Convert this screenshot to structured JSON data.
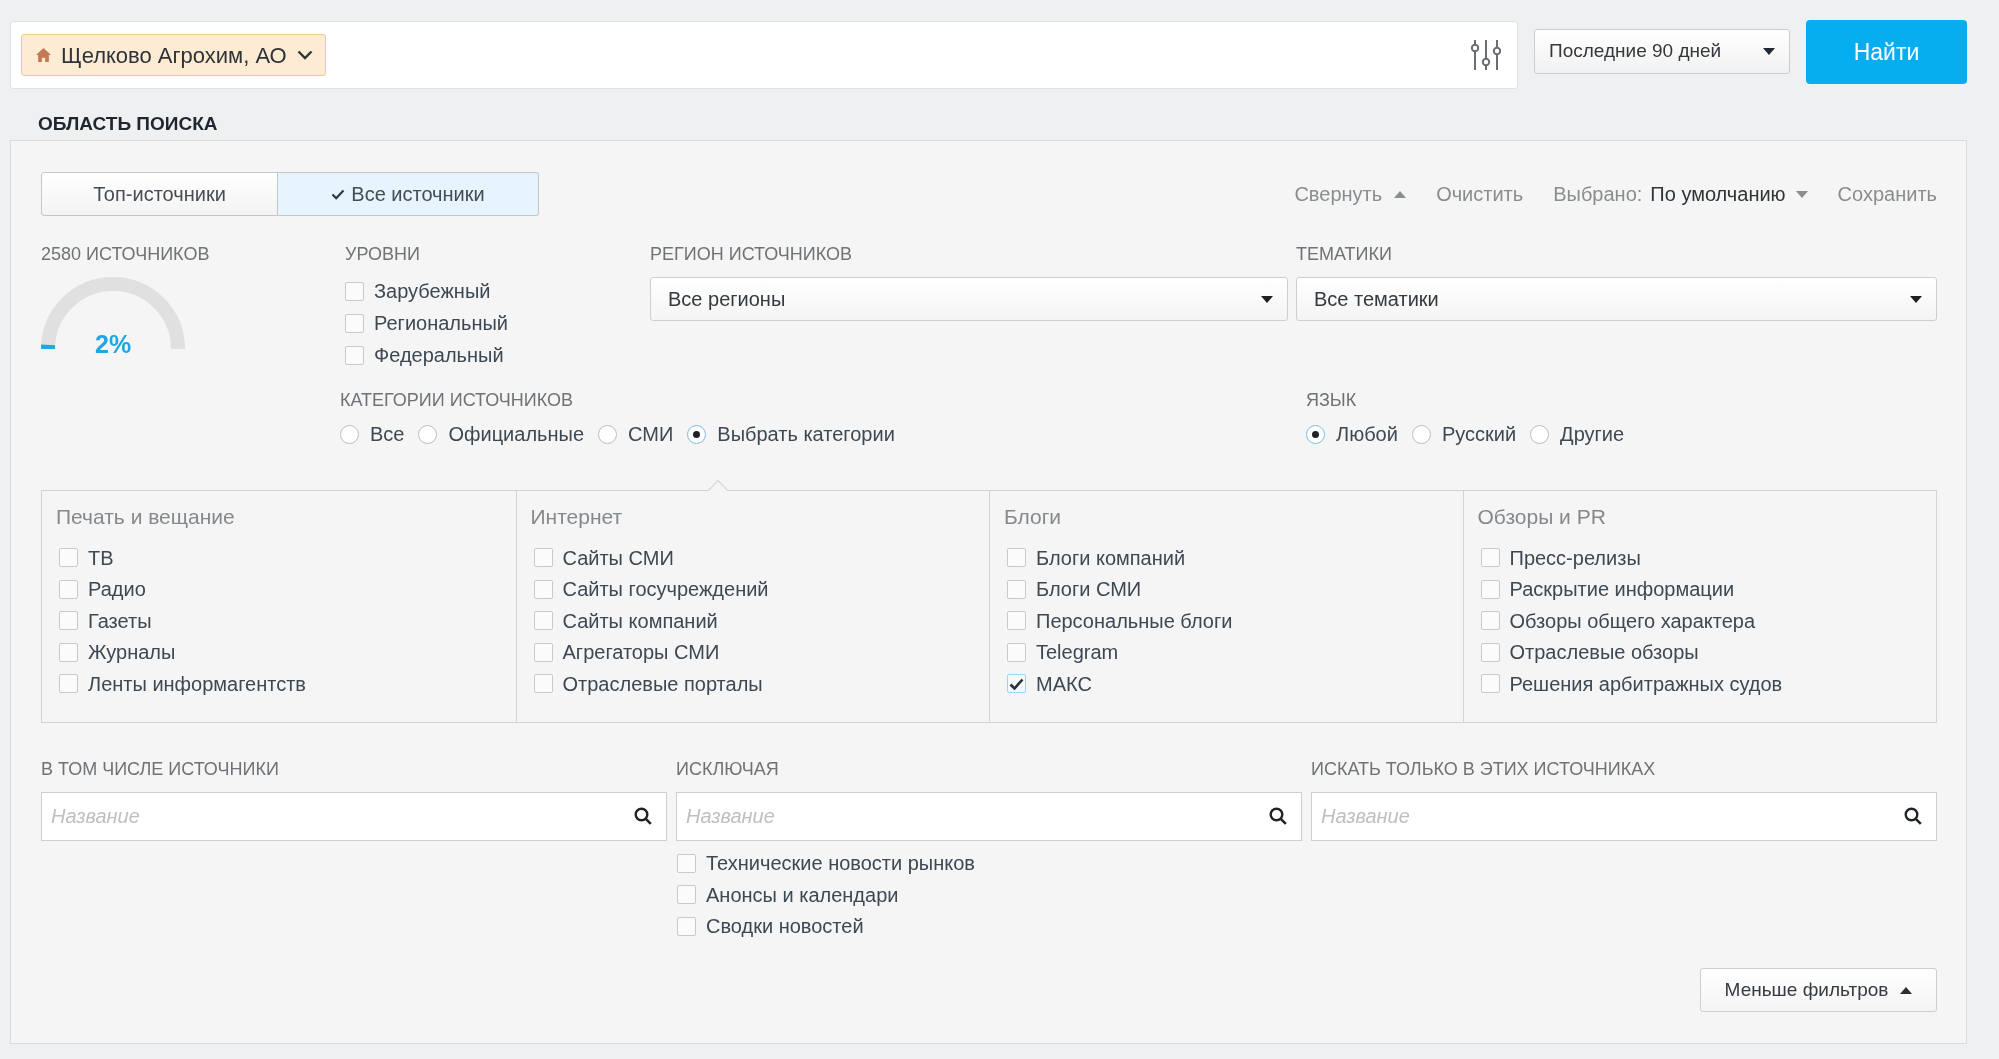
{
  "search_bar": {
    "company": "Щелково Агрохим, АО",
    "period": "Последние 90 дней",
    "find_button": "Найти"
  },
  "section_title": "ОБЛАСТЬ ПОИСКА",
  "source_tabs": [
    {
      "label": "Топ-источники",
      "selected": false
    },
    {
      "label": "Все источники",
      "selected": true
    }
  ],
  "actions": {
    "collapse": "Свернуть",
    "clear": "Очистить",
    "preset_label": "Выбрано:",
    "preset_value": "По умолчанию",
    "save": "Сохранить"
  },
  "sources_count": {
    "label": "2580 ИСТОЧНИКОВ",
    "percent": "2%",
    "level": 0.02
  },
  "levels": {
    "label": "УРОВНИ",
    "items": [
      {
        "label": "Зарубежный",
        "checked": false
      },
      {
        "label": "Региональный",
        "checked": false
      },
      {
        "label": "Федеральный",
        "checked": false
      }
    ]
  },
  "region": {
    "label": "РЕГИОН ИСТОЧНИКОВ",
    "value": "Все регионы"
  },
  "topics": {
    "label": "ТЕМАТИКИ",
    "value": "Все тематики"
  },
  "categories": {
    "label": "КАТЕГОРИИ ИСТОЧНИКОВ",
    "options": [
      {
        "label": "Все",
        "selected": false
      },
      {
        "label": "Официальные",
        "selected": false
      },
      {
        "label": "СМИ",
        "selected": false
      },
      {
        "label": "Выбрать категории",
        "selected": true
      }
    ]
  },
  "language": {
    "label": "ЯЗЫК",
    "options": [
      {
        "label": "Любой",
        "selected": true
      },
      {
        "label": "Русский",
        "selected": false
      },
      {
        "label": "Другие",
        "selected": false
      }
    ]
  },
  "category_groups": [
    {
      "title": "Печать и вещание",
      "items": [
        {
          "label": "ТВ",
          "checked": false
        },
        {
          "label": "Радио",
          "checked": false
        },
        {
          "label": "Газеты",
          "checked": false
        },
        {
          "label": "Журналы",
          "checked": false
        },
        {
          "label": "Ленты информагентств",
          "checked": false
        }
      ]
    },
    {
      "title": "Интернет",
      "items": [
        {
          "label": "Сайты СМИ",
          "checked": false
        },
        {
          "label": "Сайты госучреждений",
          "checked": false
        },
        {
          "label": "Сайты компаний",
          "checked": false
        },
        {
          "label": "Агрегаторы СМИ",
          "checked": false
        },
        {
          "label": "Отраслевые порталы",
          "checked": false
        }
      ]
    },
    {
      "title": "Блоги",
      "items": [
        {
          "label": "Блоги компаний",
          "checked": false
        },
        {
          "label": "Блоги СМИ",
          "checked": false
        },
        {
          "label": "Персональные блоги",
          "checked": false
        },
        {
          "label": "Telegram",
          "checked": false
        },
        {
          "label": "МАКС",
          "checked": true
        }
      ]
    },
    {
      "title": "Обзоры и PR",
      "items": [
        {
          "label": "Пресс-релизы",
          "checked": false
        },
        {
          "label": "Раскрытие информации",
          "checked": false
        },
        {
          "label": "Обзоры общего характера",
          "checked": false
        },
        {
          "label": "Отраслевые обзоры",
          "checked": false
        },
        {
          "label": "Решения арбитражных судов",
          "checked": false
        }
      ]
    }
  ],
  "source_filters": [
    {
      "label": "В ТОМ ЧИСЛЕ ИСТОЧНИКИ",
      "placeholder": "Название"
    },
    {
      "label": "ИСКЛЮЧАЯ",
      "placeholder": "Название",
      "options": [
        {
          "label": "Технические новости рынков",
          "checked": false
        },
        {
          "label": "Анонсы и календари",
          "checked": false
        },
        {
          "label": "Сводки новостей",
          "checked": false
        }
      ]
    },
    {
      "label": "ИСКАТЬ ТОЛЬКО В ЭТИХ ИСТОЧНИКАХ",
      "placeholder": "Название"
    }
  ],
  "less_filters_button": "Меньше фильтров"
}
